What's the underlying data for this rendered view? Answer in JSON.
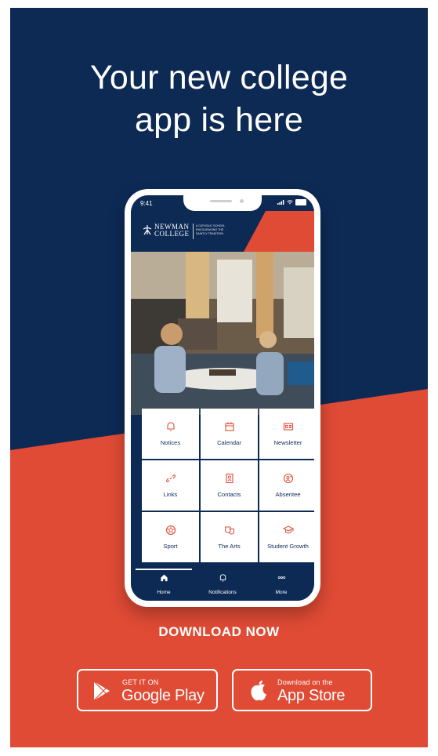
{
  "headline": {
    "line1": "Your new college",
    "line2": "app is here"
  },
  "colors": {
    "navy": "#0d2a55",
    "red": "#e04b35",
    "white": "#ffffff"
  },
  "phone": {
    "status": {
      "time": "9:41"
    },
    "logo": {
      "line1": "NEWMAN",
      "line2": "COLLEGE",
      "tagline": "A CATHOLIC SCHOOL ENCOURAGING THE SAINTLY TRADITION"
    },
    "tiles": [
      {
        "label": "Notices",
        "icon": "bell-icon"
      },
      {
        "label": "Calendar",
        "icon": "calendar-icon"
      },
      {
        "label": "Newsletter",
        "icon": "newsletter-icon"
      },
      {
        "label": "Links",
        "icon": "link-icon"
      },
      {
        "label": "Contacts",
        "icon": "contact-card-icon"
      },
      {
        "label": "Absentee",
        "icon": "absentee-icon"
      },
      {
        "label": "Sport",
        "icon": "ball-icon"
      },
      {
        "label": "The Arts",
        "icon": "theatre-masks-icon"
      },
      {
        "label": "Student Growth",
        "icon": "graduation-cap-icon"
      }
    ],
    "tabs": [
      {
        "label": "Home",
        "icon": "home-icon"
      },
      {
        "label": "Notifications",
        "icon": "bell-icon"
      },
      {
        "label": "More",
        "icon": "more-dots-icon"
      }
    ]
  },
  "cta": {
    "download": "DOWNLOAD NOW"
  },
  "stores": {
    "google": {
      "small": "GET IT ON",
      "big": "Google Play",
      "icon": "google-play-icon"
    },
    "apple": {
      "small": "Download on the",
      "big": "App Store",
      "icon": "apple-icon"
    }
  }
}
